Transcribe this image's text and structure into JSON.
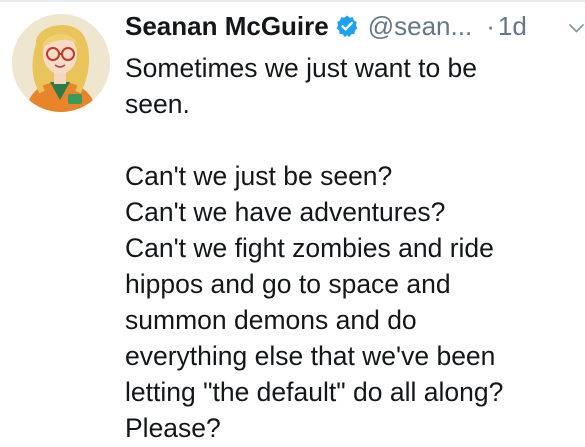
{
  "tweet": {
    "display_name": "Seanan McGuire",
    "handle": "@sean...",
    "dot": "·",
    "timestamp": "1d",
    "verified": true,
    "accent_color": "#1da1f2",
    "text_color": "#14171a",
    "muted_color": "#657786",
    "body_lines": [
      "Sometimes we just want to be",
      "seen.",
      "",
      "Can't we just be seen?",
      "Can't we have adventures?",
      "Can't we fight zombies and ride",
      "hippos and go to space and",
      "summon demons and do",
      "everything else that we've been",
      "letting \"the default\" do all along?",
      "Please?"
    ]
  },
  "icons": {
    "verified": "verified-badge-icon",
    "menu": "chevron-down-icon",
    "avatar": "avatar-illustration"
  }
}
